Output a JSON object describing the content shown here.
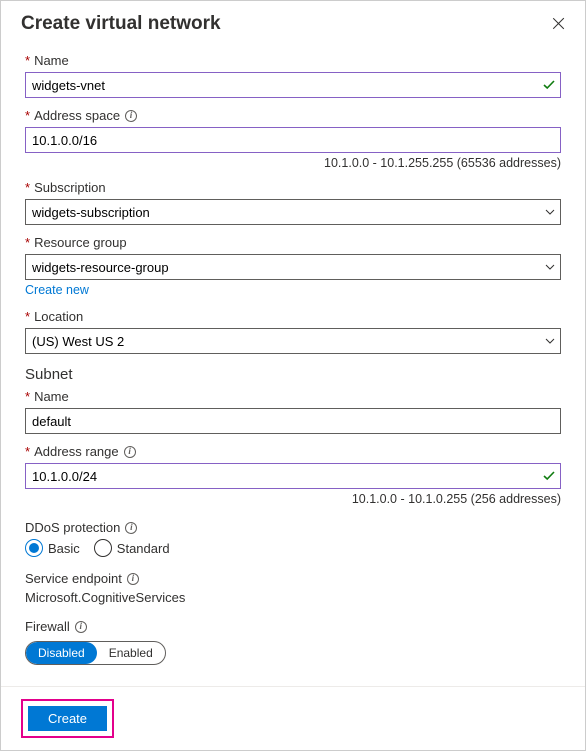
{
  "header": {
    "title": "Create virtual network"
  },
  "name": {
    "label": "Name",
    "value": "widgets-vnet"
  },
  "addressSpace": {
    "label": "Address space",
    "value": "10.1.0.0/16",
    "helper": "10.1.0.0 - 10.1.255.255 (65536 addresses)"
  },
  "subscription": {
    "label": "Subscription",
    "value": "widgets-subscription"
  },
  "resourceGroup": {
    "label": "Resource group",
    "value": "widgets-resource-group",
    "createNew": "Create new"
  },
  "location": {
    "label": "Location",
    "value": "(US) West US 2"
  },
  "subnet": {
    "section": "Subnet",
    "name": {
      "label": "Name",
      "value": "default"
    },
    "range": {
      "label": "Address range",
      "value": "10.1.0.0/24",
      "helper": "10.1.0.0 - 10.1.0.255 (256 addresses)"
    }
  },
  "ddos": {
    "label": "DDoS protection",
    "opt1": "Basic",
    "opt2": "Standard"
  },
  "serviceEndpoint": {
    "label": "Service endpoint",
    "value": "Microsoft.CognitiveServices"
  },
  "firewall": {
    "label": "Firewall",
    "opt1": "Disabled",
    "opt2": "Enabled"
  },
  "footer": {
    "create": "Create"
  }
}
